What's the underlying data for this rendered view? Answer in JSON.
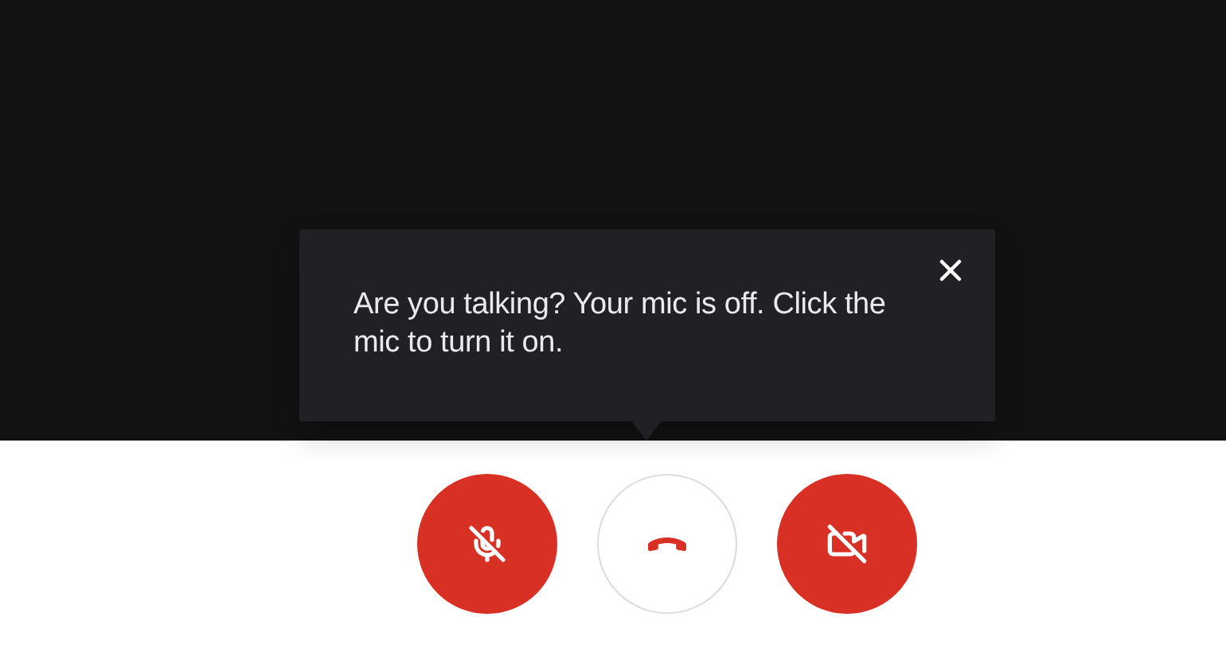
{
  "tooltip": {
    "message": "Are you talking? Your mic is off. Click the mic to turn it on."
  },
  "controls": [
    {
      "kind": "mic",
      "off": true
    },
    {
      "kind": "hangup"
    },
    {
      "kind": "camera",
      "off": true
    }
  ]
}
